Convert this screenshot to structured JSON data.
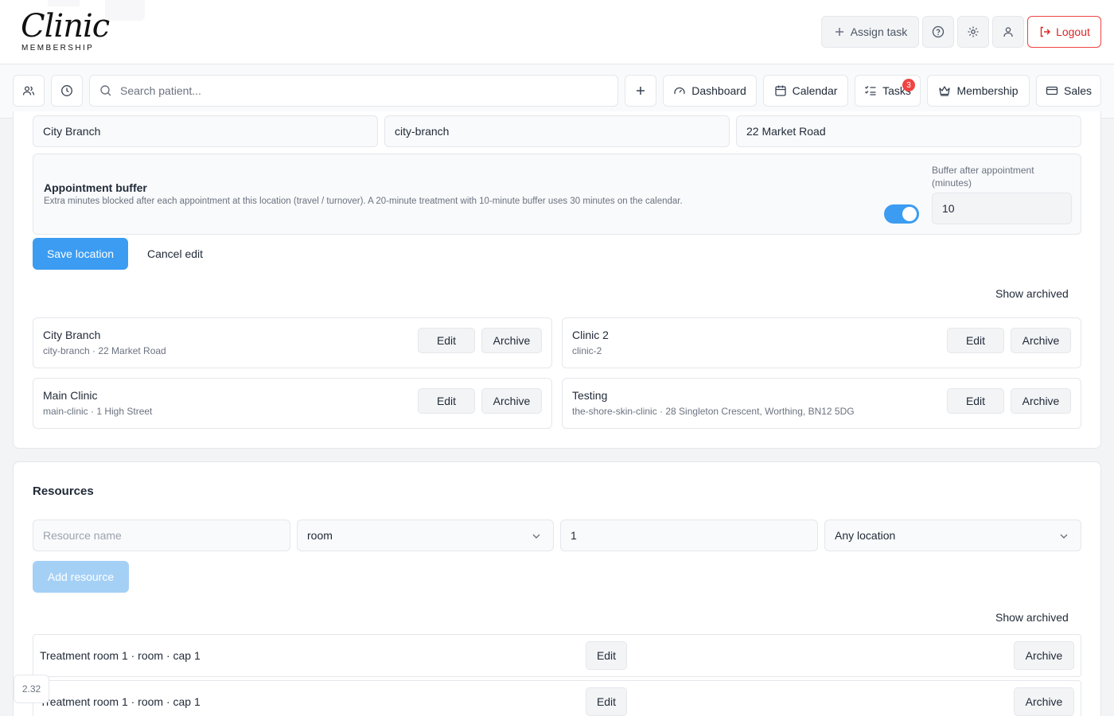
{
  "brand": {
    "logo_text": "Clinic",
    "logo_sub": "MEMBERSHIP"
  },
  "header": {
    "assign_task": "Assign task",
    "logout": "Logout"
  },
  "nav": {
    "search_placeholder": "Search patient...",
    "dashboard": "Dashboard",
    "calendar": "Calendar",
    "tasks": "Tasks",
    "tasks_badge": "3",
    "membership": "Membership",
    "sales": "Sales"
  },
  "location_form": {
    "name": "City Branch",
    "slug": "city-branch",
    "address": "22 Market Road",
    "buffer_title": "Appointment buffer",
    "buffer_desc": "Extra minutes blocked after each appointment at this location (travel / turnover). A 20-minute treatment with 10-minute buffer uses 30 minutes on the calendar.",
    "buffer_enabled": true,
    "buffer_label": "Buffer after appointment (minutes)",
    "buffer_value": "10",
    "save": "Save location",
    "cancel": "Cancel edit"
  },
  "locations": {
    "show_archived": "Show archived",
    "edit": "Edit",
    "archive": "Archive",
    "items": [
      {
        "name": "City Branch",
        "sub": "city-branch · 22 Market Road"
      },
      {
        "name": "Clinic 2",
        "sub": "clinic-2"
      },
      {
        "name": "Main Clinic",
        "sub": "main-clinic · 1 High Street"
      },
      {
        "name": "Testing",
        "sub": "the-shore-skin-clinic · 28 Singleton Crescent, Worthing, BN12 5DG"
      }
    ]
  },
  "resources": {
    "title": "Resources",
    "name_placeholder": "Resource name",
    "type": "room",
    "capacity": "1",
    "location": "Any location",
    "add": "Add resource",
    "show_archived": "Show archived",
    "edit": "Edit",
    "archive": "Archive",
    "items": [
      "Treatment room 1 · room · cap 1",
      "Treatment room 1 · room · cap 1"
    ]
  },
  "version": "2.32",
  "colors": {
    "accent": "#3b9cf2",
    "danger": "#dc2626"
  }
}
